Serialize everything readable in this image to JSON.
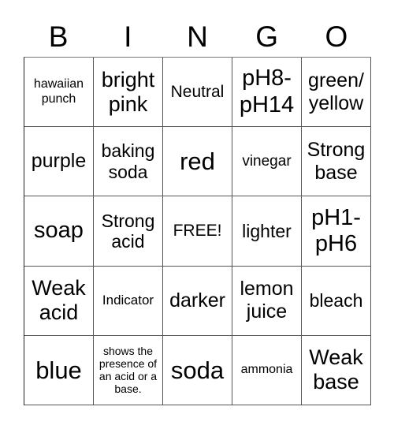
{
  "header": [
    "B",
    "I",
    "N",
    "G",
    "O"
  ],
  "cells": [
    [
      "hawaiian punch",
      "bright pink",
      "Neutral",
      "pH8- pH14",
      "green/ yellow"
    ],
    [
      "purple",
      "baking soda",
      "red",
      "vinegar",
      "Strong base"
    ],
    [
      "soap",
      "Strong acid",
      "FREE!",
      "lighter",
      "pH1- pH6"
    ],
    [
      "Weak acid",
      "Indicator",
      "darker",
      "lemon juice",
      "bleach"
    ],
    [
      "blue",
      "shows the presence of an acid or a base.",
      "soda",
      "ammonia",
      "Weak base"
    ]
  ]
}
